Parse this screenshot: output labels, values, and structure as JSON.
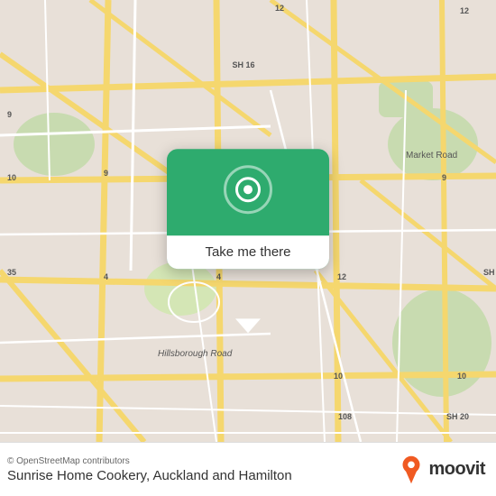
{
  "map": {
    "background_color": "#e8e0d8"
  },
  "popup": {
    "button_label": "Take me there",
    "icon_name": "location-pin-icon"
  },
  "bottom_bar": {
    "copyright": "© OpenStreetMap contributors",
    "location_name": "Sunrise Home Cookery, Auckland and Hamilton",
    "moovit_label": "moovit"
  }
}
